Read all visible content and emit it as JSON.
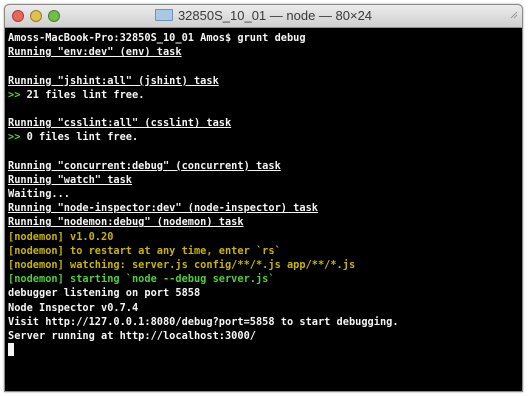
{
  "window": {
    "title": "32850S_10_01 — node — 80×24"
  },
  "lines": [
    {
      "text": "Amoss-MacBook-Pro:32850S_10_01 Amos$ grunt debug",
      "style": ""
    },
    {
      "text": "Running \"env:dev\" (env) task",
      "style": "u"
    },
    {
      "text": "",
      "style": ""
    },
    {
      "text": "Running \"jshint:all\" (jshint) task",
      "style": "u"
    },
    {
      "text": ">> 21 files lint free.",
      "style": "gprefix"
    },
    {
      "text": "",
      "style": ""
    },
    {
      "text": "Running \"csslint:all\" (csslint) task",
      "style": "u"
    },
    {
      "text": ">> 0 files lint free.",
      "style": "gprefix"
    },
    {
      "text": "",
      "style": ""
    },
    {
      "text": "Running \"concurrent:debug\" (concurrent) task",
      "style": "u"
    },
    {
      "text": "Running \"watch\" task",
      "style": "u"
    },
    {
      "text": "Waiting...",
      "style": ""
    },
    {
      "text": "Running \"node-inspector:dev\" (node-inspector) task",
      "style": "u"
    },
    {
      "text": "Running \"nodemon:debug\" (nodemon) task",
      "style": "u"
    },
    {
      "text": "[nodemon] v1.0.20",
      "style": "y"
    },
    {
      "text": "[nodemon] to restart at any time, enter `rs`",
      "style": "y"
    },
    {
      "text": "[nodemon] watching: server.js config/**/*.js app/**/*.js",
      "style": "y"
    },
    {
      "text": "[nodemon] starting `node --debug server.js`",
      "style": "g"
    },
    {
      "text": "debugger listening on port 5858",
      "style": ""
    },
    {
      "text": "Node Inspector v0.7.4",
      "style": ""
    },
    {
      "text": "Visit http://127.0.0.1:8080/debug?port=5858 to start debugging.",
      "style": ""
    },
    {
      "text": "Server running at http://localhost:3000/",
      "style": ""
    }
  ],
  "colors": {
    "background": "#000000",
    "foreground": "#f5f5f5",
    "green": "#4fcf3a",
    "yellow": "#c9b400"
  }
}
